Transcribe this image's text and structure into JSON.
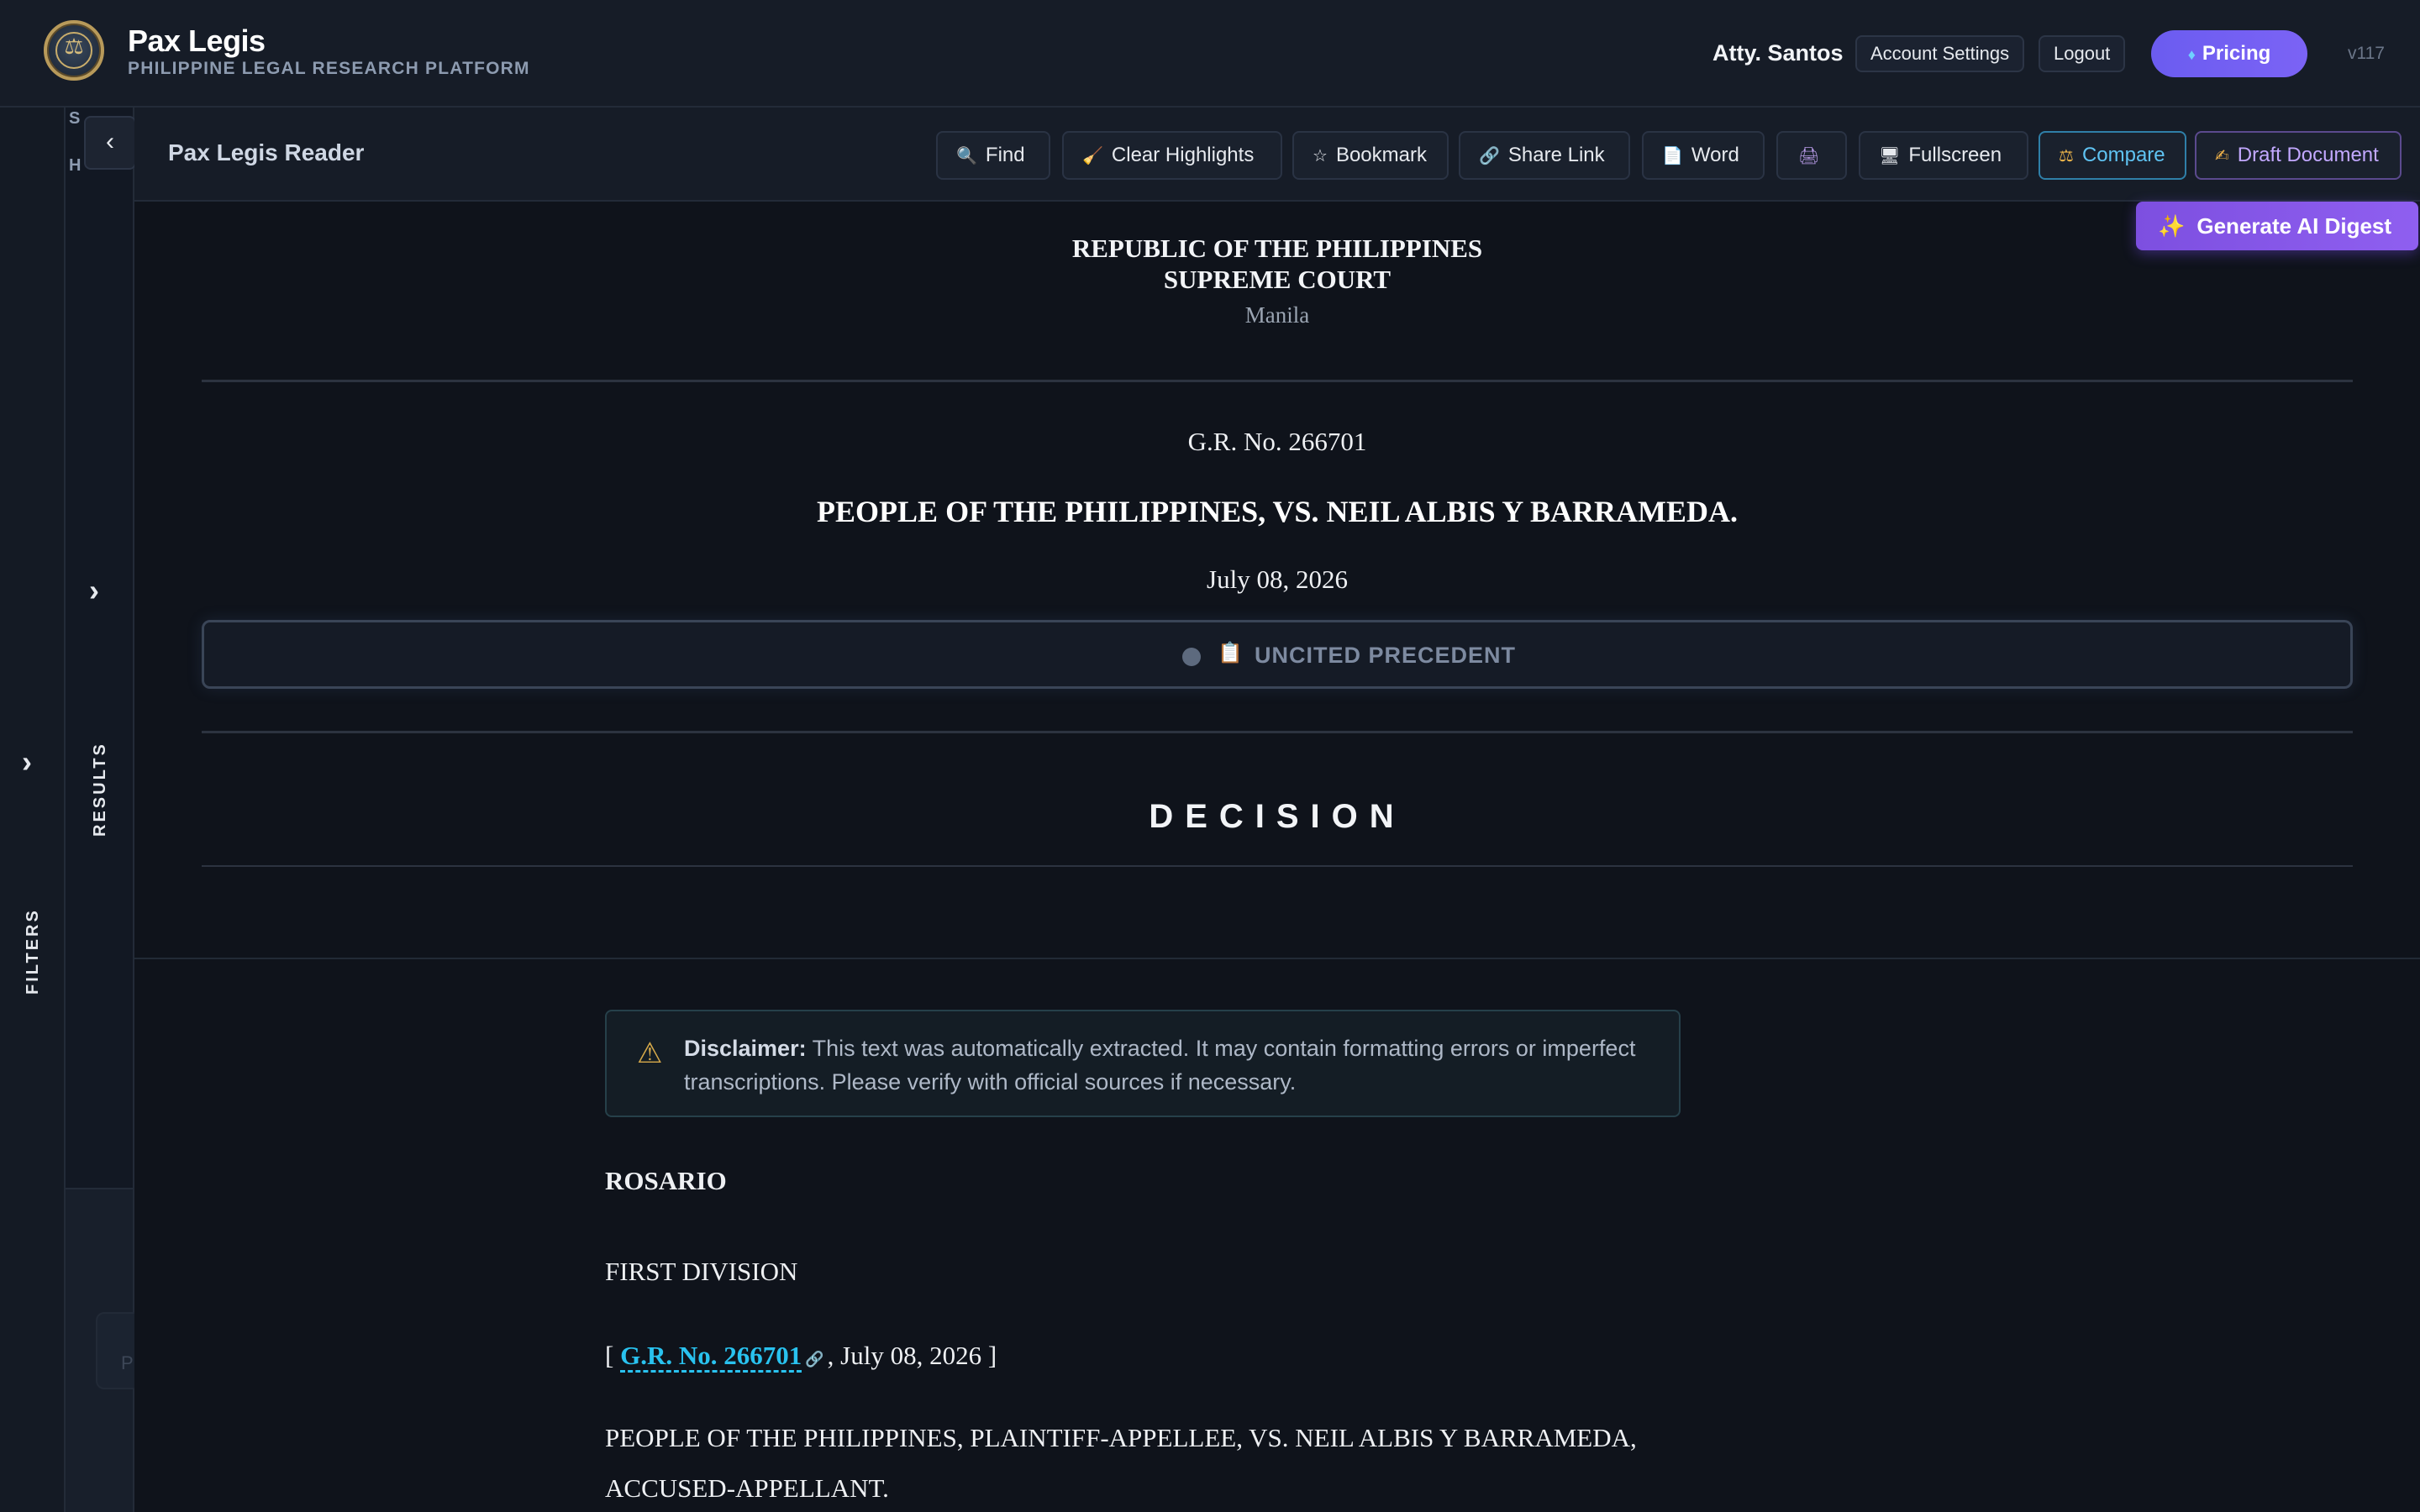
{
  "app": {
    "logo_text": "Pax Legis",
    "title": "Pax Legis",
    "subtitle": "PHILIPPINE LEGAL RESEARCH PLATFORM",
    "user": "Atty. Santos",
    "account_settings": "Account Settings",
    "logout": "Logout",
    "pricing": "Pricing",
    "version": "v117"
  },
  "sidebar": {
    "filters_label": "FILTERS",
    "results_label": "RESULTS",
    "letters": [
      "S",
      "H"
    ],
    "ghost_letter": "P",
    "collapse_glyph": "‹",
    "expand_glyph": "›"
  },
  "reader": {
    "title": "Pax Legis Reader",
    "toolbar": {
      "find": "Find",
      "clear_highlights": "Clear Highlights",
      "bookmark": "Bookmark",
      "share_link": "Share Link",
      "word": "Word",
      "fullscreen": "Fullscreen",
      "compare": "Compare",
      "draft_document": "Draft Document"
    },
    "ai_digest": "Generate AI Digest"
  },
  "document": {
    "republic": "REPUBLIC OF THE PHILIPPINES",
    "court": "SUPREME COURT",
    "city": "Manila",
    "gr_no": "G.R. No. 266701",
    "case_title": "PEOPLE OF THE PHILIPPINES, VS. NEIL ALBIS Y BARRAMEDA.",
    "date": "July 08, 2026",
    "status": "UNCITED PRECEDENT",
    "decision_heading": "DECISION",
    "disclaimer_label": "Disclaimer:",
    "disclaimer_text": "This text was automatically extracted. It may contain formatting errors or imperfect transcriptions. Please verify with official sources if necessary.",
    "ponente": "ROSARIO",
    "division": "FIRST DIVISION",
    "citation_open": "[",
    "citation_link": "G.R. No. 266701",
    "citation_rest": ", July 08, 2026 ]",
    "parties_line1": "PEOPLE OF THE PHILIPPINES, PLAINTIFF-APPELLEE, VS. NEIL ALBIS Y BARRAMEDA,",
    "parties_line2": "ACCUSED-APPELLANT."
  },
  "colors": {
    "background": "#10141c",
    "accent_link": "#29c2ef",
    "pricing": "#6b5cf0",
    "ai_digest": "#8f5ff0"
  }
}
